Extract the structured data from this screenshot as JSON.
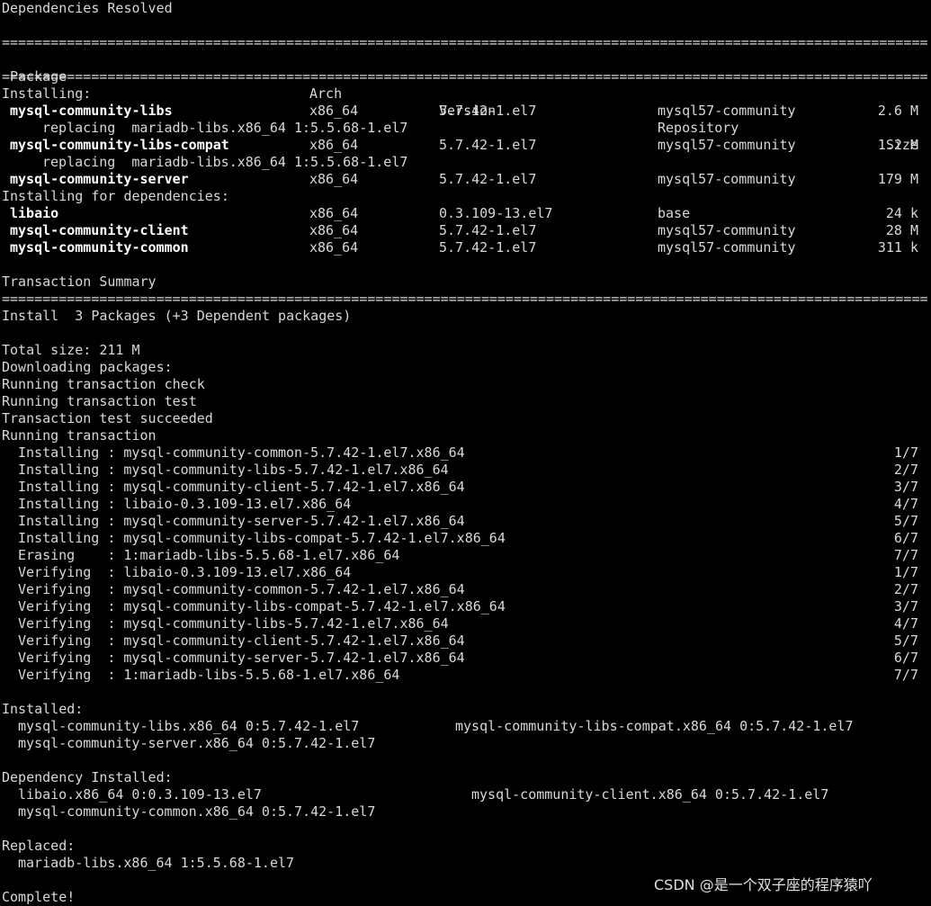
{
  "terminal": {
    "header": "Dependencies Resolved",
    "separator": "=========================================================================================================================",
    "columns": {
      "package": "Package",
      "arch": "Arch",
      "version": "Version",
      "repository": "Repository",
      "size": "Size"
    },
    "installing_label": "Installing:",
    "installing": [
      {
        "name": "mysql-community-libs",
        "arch": "x86_64",
        "version": "5.7.42-1.el7",
        "repo": "mysql57-community",
        "size": "2.6 M",
        "replacing": "replacing  mariadb-libs.x86_64 1:5.5.68-1.el7"
      },
      {
        "name": "mysql-community-libs-compat",
        "arch": "x86_64",
        "version": "5.7.42-1.el7",
        "repo": "mysql57-community",
        "size": "1.2 M",
        "replacing": "replacing  mariadb-libs.x86_64 1:5.5.68-1.el7"
      },
      {
        "name": "mysql-community-server",
        "arch": "x86_64",
        "version": "5.7.42-1.el7",
        "repo": "mysql57-community",
        "size": "179 M"
      }
    ],
    "deps_label": "Installing for dependencies:",
    "deps": [
      {
        "name": "libaio",
        "arch": "x86_64",
        "version": "0.3.109-13.el7",
        "repo": "base",
        "size": "24 k"
      },
      {
        "name": "mysql-community-client",
        "arch": "x86_64",
        "version": "5.7.42-1.el7",
        "repo": "mysql57-community",
        "size": "28 M"
      },
      {
        "name": "mysql-community-common",
        "arch": "x86_64",
        "version": "5.7.42-1.el7",
        "repo": "mysql57-community",
        "size": "311 k"
      }
    ],
    "summary_label": "Transaction Summary",
    "summary_line": "Install  3 Packages (+3 Dependent packages)",
    "log": [
      "Total size: 211 M",
      "Downloading packages:",
      "Running transaction check",
      "Running transaction test",
      "Transaction test succeeded",
      "Running transaction"
    ],
    "steps": [
      {
        "text": "Installing : mysql-community-common-5.7.42-1.el7.x86_64",
        "count": "1/7"
      },
      {
        "text": "Installing : mysql-community-libs-5.7.42-1.el7.x86_64",
        "count": "2/7"
      },
      {
        "text": "Installing : mysql-community-client-5.7.42-1.el7.x86_64",
        "count": "3/7"
      },
      {
        "text": "Installing : libaio-0.3.109-13.el7.x86_64",
        "count": "4/7"
      },
      {
        "text": "Installing : mysql-community-server-5.7.42-1.el7.x86_64",
        "count": "5/7"
      },
      {
        "text": "Installing : mysql-community-libs-compat-5.7.42-1.el7.x86_64",
        "count": "6/7"
      },
      {
        "text": "Erasing    : 1:mariadb-libs-5.5.68-1.el7.x86_64",
        "count": "7/7"
      },
      {
        "text": "Verifying  : libaio-0.3.109-13.el7.x86_64",
        "count": "1/7"
      },
      {
        "text": "Verifying  : mysql-community-common-5.7.42-1.el7.x86_64",
        "count": "2/7"
      },
      {
        "text": "Verifying  : mysql-community-libs-compat-5.7.42-1.el7.x86_64",
        "count": "3/7"
      },
      {
        "text": "Verifying  : mysql-community-libs-5.7.42-1.el7.x86_64",
        "count": "4/7"
      },
      {
        "text": "Verifying  : mysql-community-client-5.7.42-1.el7.x86_64",
        "count": "5/7"
      },
      {
        "text": "Verifying  : mysql-community-server-5.7.42-1.el7.x86_64",
        "count": "6/7"
      },
      {
        "text": "Verifying  : 1:mariadb-libs-5.5.68-1.el7.x86_64",
        "count": "7/7"
      }
    ],
    "installed_label": "Installed:",
    "installed": [
      {
        "a": "mysql-community-libs.x86_64 0:5.7.42-1.el7",
        "b": "mysql-community-libs-compat.x86_64 0:5.7.42-1.el7"
      },
      {
        "a": "mysql-community-server.x86_64 0:5.7.42-1.el7",
        "b": ""
      }
    ],
    "dep_installed_label": "Dependency Installed:",
    "dep_installed": [
      {
        "a": "libaio.x86_64 0:0.3.109-13.el7",
        "b": "mysql-community-client.x86_64 0:5.7.42-1.el7"
      },
      {
        "a": "mysql-community-common.x86_64 0:5.7.42-1.el7",
        "b": ""
      }
    ],
    "replaced_label": "Replaced:",
    "replaced": [
      {
        "a": "mariadb-libs.x86_64 1:5.5.68-1.el7",
        "b": ""
      }
    ],
    "complete": "Complete!"
  },
  "watermark": "CSDN @是一个双子座的程序猿吖",
  "colors": {
    "background": "#000000",
    "text": "#d8d8d8",
    "bold_text": "#ffffff"
  }
}
